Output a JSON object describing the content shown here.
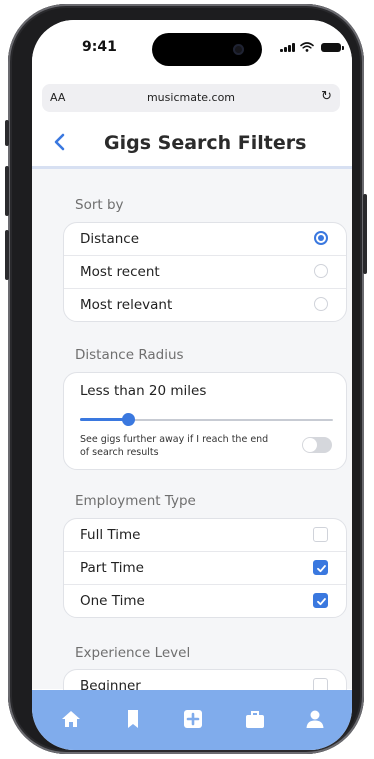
{
  "status_bar": {
    "time": "9:41"
  },
  "browser": {
    "text_size": "AA",
    "url": "musicmate.com",
    "reload_glyph": "↻"
  },
  "header": {
    "title": "Gigs Search Filters"
  },
  "sort_by": {
    "label": "Sort by",
    "options": [
      {
        "label": "Distance",
        "selected": true
      },
      {
        "label": "Most recent",
        "selected": false
      },
      {
        "label": "Most relevant",
        "selected": false
      }
    ]
  },
  "distance_radius": {
    "label": "Distance Radius",
    "value_text": "Less than 20 miles",
    "slider_level": 0.19,
    "toggle_text": "See gigs further away if I reach the end of search results",
    "toggle_on": false
  },
  "employment_type": {
    "label": "Employment Type",
    "options": [
      {
        "label": "Full Time",
        "checked": false
      },
      {
        "label": "Part Time",
        "checked": true
      },
      {
        "label": "One Time",
        "checked": true
      }
    ]
  },
  "experience_level": {
    "label": "Experience Level",
    "options": [
      {
        "label": "Beginner",
        "checked": false
      }
    ]
  },
  "bottom_nav": {
    "items": [
      {
        "icon": "home-icon"
      },
      {
        "icon": "bookmark-icon"
      },
      {
        "icon": "add-icon"
      },
      {
        "icon": "briefcase-icon"
      },
      {
        "icon": "profile-icon"
      }
    ]
  },
  "colors": {
    "accent": "#3a78df",
    "nav_background": "#80acec",
    "content_background": "#f5f6f8"
  }
}
